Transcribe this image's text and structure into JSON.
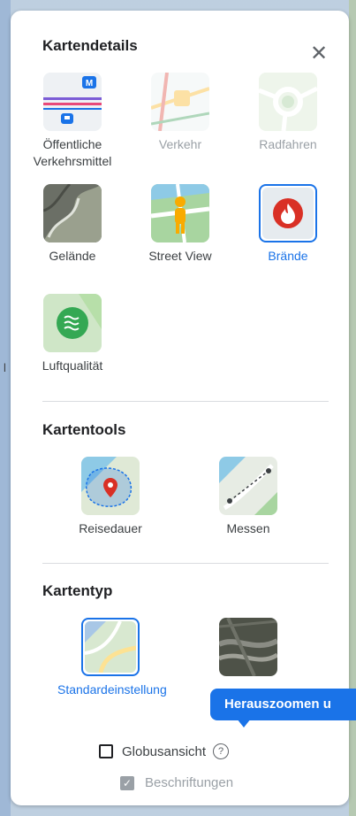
{
  "panel": {
    "title": "Kartendetails",
    "close_label": "✕",
    "details": [
      {
        "label": "Öffentliche\nVerkehrsmittel",
        "state": "normal",
        "icon": "transit-icon"
      },
      {
        "label": "Verkehr",
        "state": "disabled",
        "icon": "traffic-icon"
      },
      {
        "label": "Radfahren",
        "state": "disabled",
        "icon": "bicycle-icon"
      },
      {
        "label": "Gelände",
        "state": "normal",
        "icon": "terrain-icon"
      },
      {
        "label": "Street View",
        "state": "normal",
        "icon": "street-view-icon"
      },
      {
        "label": "Brände",
        "state": "selected",
        "icon": "fire-icon"
      },
      {
        "label": "Luftqualität",
        "state": "normal",
        "icon": "air-quality-icon"
      }
    ],
    "tools_title": "Kartentools",
    "tools": [
      {
        "label": "Reisedauer",
        "icon": "travel-time-icon"
      },
      {
        "label": "Messen",
        "icon": "measure-icon"
      }
    ],
    "type_title": "Kartentyp",
    "types": [
      {
        "label": "Standardeinstellung",
        "state": "selected",
        "icon": "default-map-icon"
      },
      {
        "label": "",
        "state": "normal",
        "icon": "satellite-icon"
      }
    ],
    "globe_label": "Globusansicht",
    "globe_help": "?",
    "labels_label": "Beschriftungen",
    "tooltip": "Herauszoomen u"
  },
  "colors": {
    "accent": "#1a73e8",
    "fire": "#d93025",
    "air": "#34a853"
  }
}
